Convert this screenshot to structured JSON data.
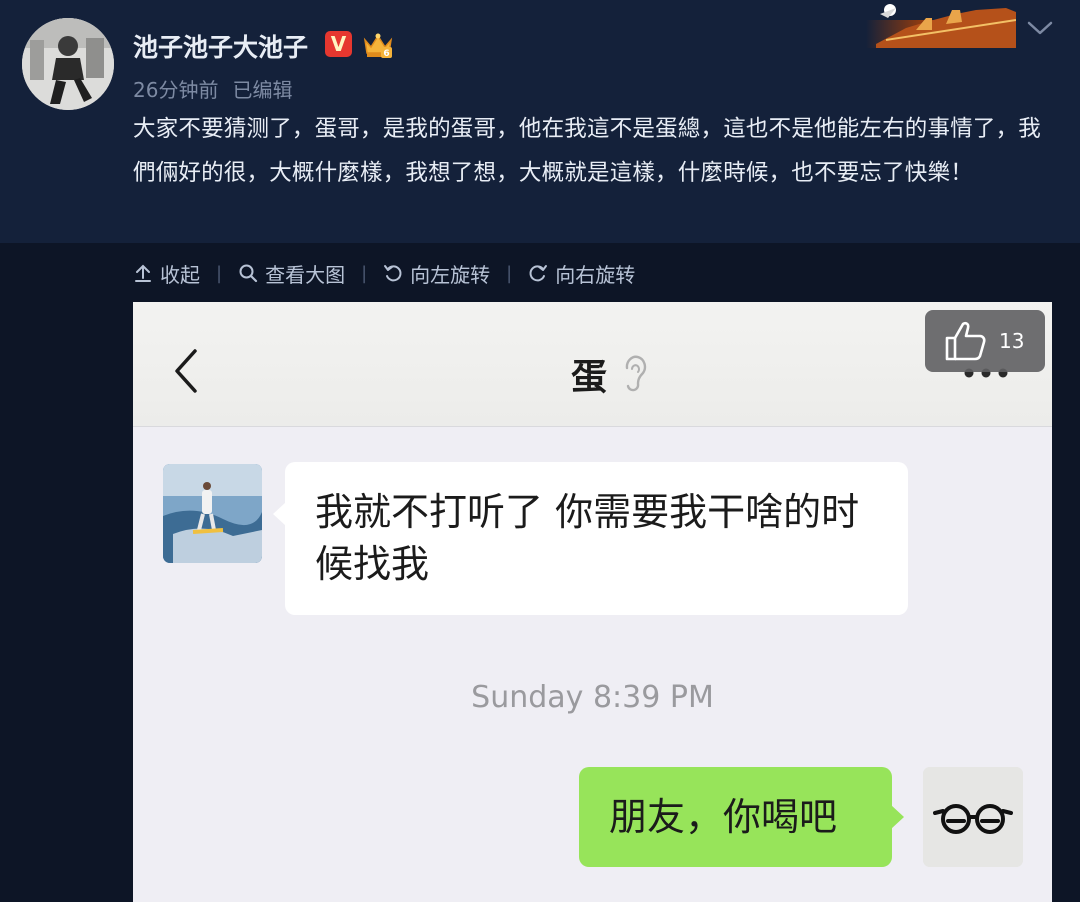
{
  "post": {
    "username": "池子池子大池子",
    "verified_badge": "V",
    "time_ago": "26分钟前",
    "edited": "已编辑",
    "text": "大家不要猜测了，蛋哥，是我的蛋哥，他在我這不是蛋總，這也不是他能左右的事情了，我們倆好的很，大概什麼樣，我想了想，大概就是這樣，什麼時候，也不要忘了快樂！"
  },
  "actions": {
    "collapse": "收起",
    "view_large": "查看大图",
    "rotate_left": "向左旋转",
    "rotate_right": "向右旋转"
  },
  "chat": {
    "title": "蛋",
    "messages": [
      {
        "sender": "friend",
        "text": "我就不打听了 你需要我干啥的时候找我"
      },
      {
        "sender": "self",
        "text": "朋友，你喝吧"
      }
    ],
    "timestamp": "Sunday 8:39 PM"
  },
  "like": {
    "count": "13"
  },
  "colors": {
    "post_bg": "#14213a",
    "page_bg": "#0d1526",
    "vip_red": "#e6372f",
    "chat_bg": "#efeef4",
    "self_bubble": "#97e45a"
  },
  "icons": [
    "chevron-down-icon",
    "collapse-icon",
    "search-icon",
    "rotate-left-icon",
    "rotate-right-icon",
    "back-arrow-icon",
    "ear-icon",
    "more-dots-icon",
    "thumbs-up-icon",
    "crown-icon"
  ]
}
